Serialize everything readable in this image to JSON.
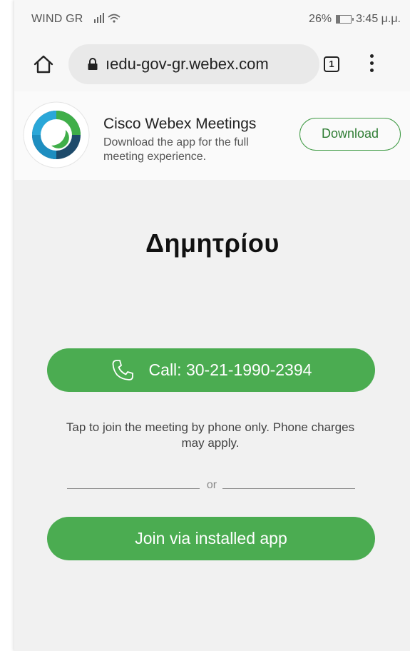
{
  "status_bar": {
    "carrier": "WIND GR",
    "battery": "26%",
    "time": "3:45 μ.μ."
  },
  "browser": {
    "url": "ıedu-gov-gr.webex.com",
    "tab_count": "1"
  },
  "app_banner": {
    "title": "Cisco Webex Meetings",
    "description": "Download the app for the full meeting experience.",
    "download_label": "Download"
  },
  "meeting": {
    "host_name": "Δημητρίου",
    "call_label": "Call: 30-21-1990-2394",
    "phone_note": "Tap to join the meeting by phone only. Phone charges may apply.",
    "or_label": "or",
    "join_label": "Join via installed app"
  },
  "colors": {
    "accent_green": "#4bac51",
    "download_border": "#3f9a44"
  },
  "icons": {
    "home": "home-icon",
    "lock": "lock-icon",
    "tabs": "tabs-icon",
    "menu": "menu-icon",
    "phone": "phone-icon",
    "app_logo": "webex-logo-icon"
  }
}
